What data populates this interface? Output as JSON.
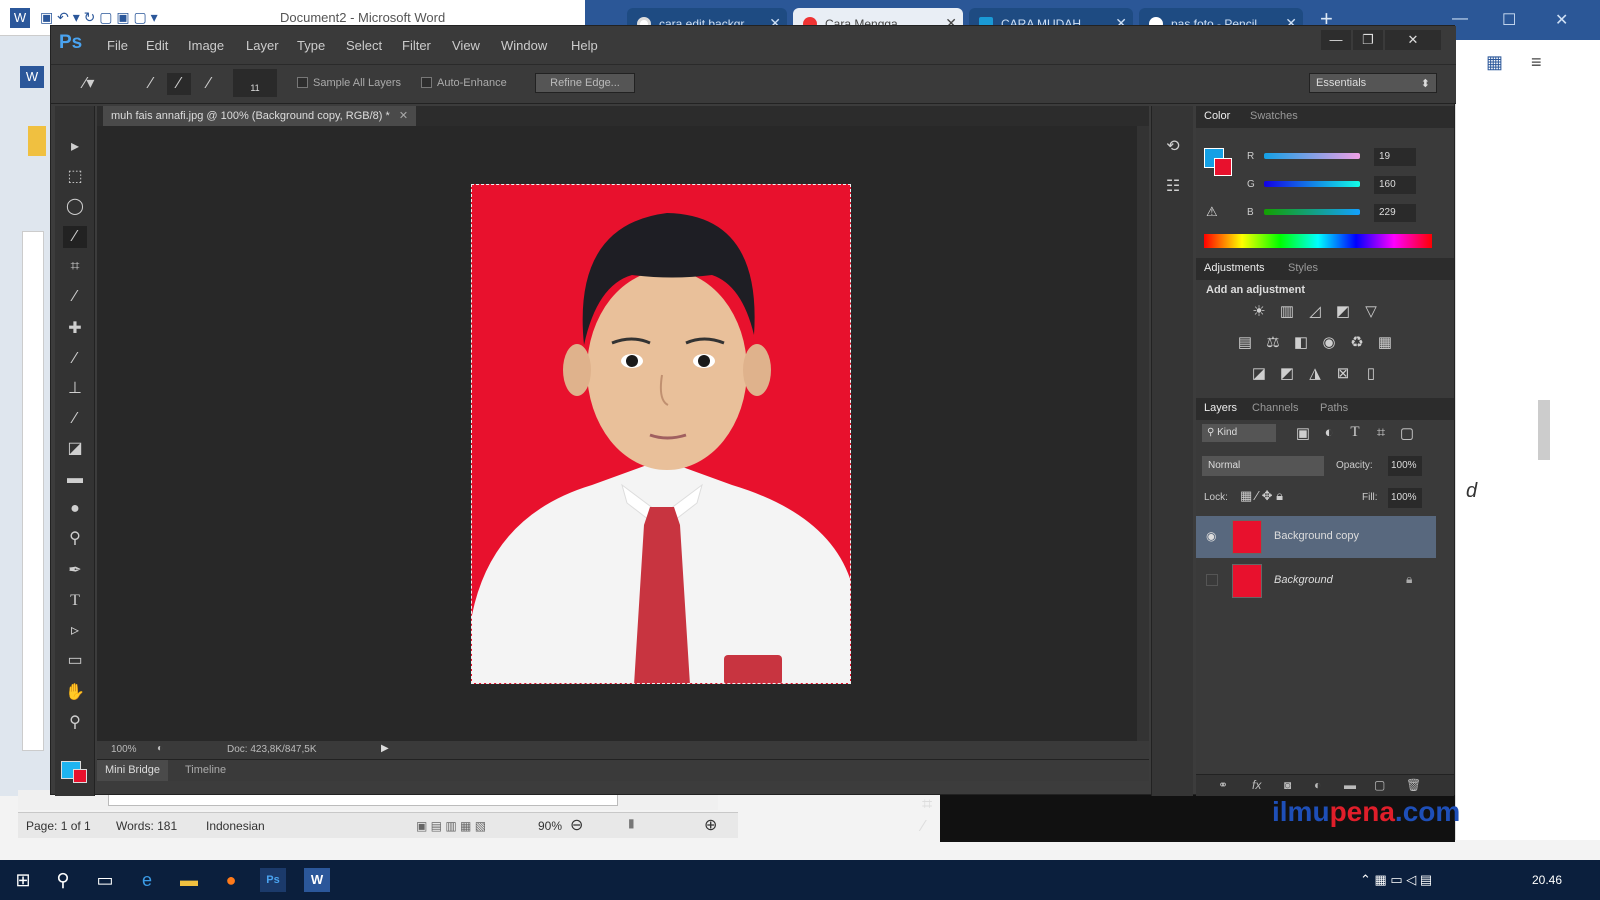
{
  "word": {
    "title": "Document2 - Microsoft Word",
    "status": {
      "page": "Page: 1 of 1",
      "words": "Words: 181",
      "language": "Indonesian",
      "zoom": "90%"
    },
    "right_fragments": [
      "d"
    ]
  },
  "browser_tabs": [
    {
      "label": "cara edit backgr",
      "active": false
    },
    {
      "label": "Cara Mengga",
      "active": true
    },
    {
      "label": "CARA MUDAH",
      "active": false
    },
    {
      "label": "pas foto - Pencil",
      "active": false
    }
  ],
  "photoshop": {
    "logo": "Ps",
    "menu": [
      "File",
      "Edit",
      "Image",
      "Layer",
      "Type",
      "Select",
      "Filter",
      "View",
      "Window",
      "Help"
    ],
    "window_controls": {
      "minimize": "—",
      "maximize": "❐",
      "close": "✕"
    },
    "options": {
      "sample_all_layers": "Sample All Layers",
      "auto_enhance": "Auto-Enhance",
      "refine_edge": "Refine Edge...",
      "brush_size": "11",
      "workspace": "Essentials"
    },
    "document": {
      "tab_title": "muh fais annafi.jpg @ 100% (Background copy, RGB/8) *",
      "zoom": "100%",
      "doc_size": "Doc: 423,8K/847,5K"
    },
    "bottom_tabs": [
      "Mini Bridge",
      "Timeline"
    ],
    "color_panel": {
      "tabs": [
        "Color",
        "Swatches"
      ],
      "r": "19",
      "g": "160",
      "b": "229",
      "labels": [
        "R",
        "G",
        "B"
      ],
      "fg_color": "#13a0e5",
      "bg_color": "#e8112d"
    },
    "adjustments_panel": {
      "tabs": [
        "Adjustments",
        "Styles"
      ],
      "heading": "Add an adjustment"
    },
    "layers_panel": {
      "tabs": [
        "Layers",
        "Channels",
        "Paths"
      ],
      "kind": "Kind",
      "blend_mode": "Normal",
      "opacity_label": "Opacity:",
      "opacity": "100%",
      "lock_label": "Lock:",
      "fill_label": "Fill:",
      "fill": "100%",
      "layers": [
        {
          "name": "Background copy",
          "selected": true,
          "visible": true
        },
        {
          "name": "Background",
          "selected": false,
          "visible": false,
          "locked": true
        }
      ]
    }
  },
  "taskbar": {
    "time": "20.46"
  },
  "watermark": {
    "part1": "ilmu",
    "part2": "pena",
    "part3": ".com"
  }
}
